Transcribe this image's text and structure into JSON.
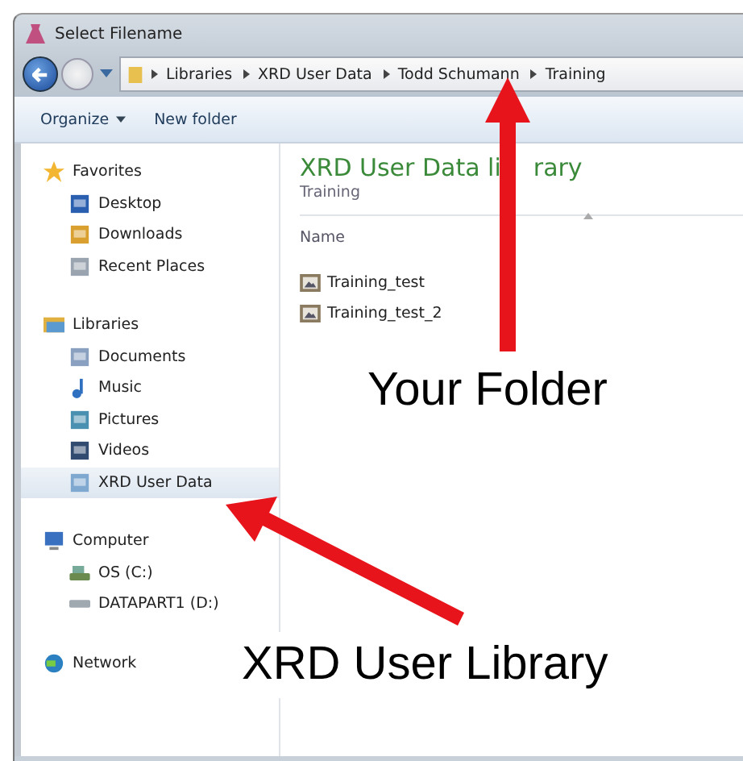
{
  "window": {
    "title": "Select Filename"
  },
  "address": {
    "crumbs": [
      "Libraries",
      "XRD User Data",
      "Todd Schumann",
      "Training"
    ]
  },
  "toolbar": {
    "buttons": [
      {
        "label": "Organize",
        "dropdown": true
      },
      {
        "label": "New folder",
        "dropdown": false
      }
    ]
  },
  "sidebar": {
    "groups": [
      {
        "label": "Favorites",
        "items": [
          {
            "label": "Desktop",
            "selected": false
          },
          {
            "label": "Downloads",
            "selected": false
          },
          {
            "label": "Recent Places",
            "selected": false
          }
        ]
      },
      {
        "label": "Libraries",
        "items": [
          {
            "label": "Documents",
            "selected": false
          },
          {
            "label": "Music",
            "selected": false
          },
          {
            "label": "Pictures",
            "selected": false
          },
          {
            "label": "Videos",
            "selected": false
          },
          {
            "label": "XRD User Data",
            "selected": true
          }
        ]
      },
      {
        "label": "Computer",
        "items": [
          {
            "label": "OS (C:)",
            "selected": false
          },
          {
            "label": "DATAPART1 (D:)",
            "selected": false
          }
        ]
      },
      {
        "label": "Network"
      }
    ]
  },
  "library": {
    "title_parts": [
      "XRD User Data li",
      "rary"
    ],
    "subtitle": "Training",
    "columns": [
      "Name"
    ],
    "files": [
      "Training_test",
      "Training_test_2"
    ]
  },
  "annotations": [
    {
      "label": "Your Folder"
    },
    {
      "label": "XRD User Library"
    }
  ]
}
